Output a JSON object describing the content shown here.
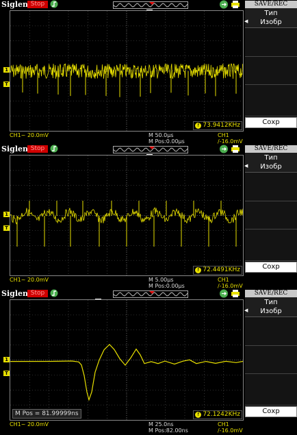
{
  "brand": "Siglent",
  "run_state": "Stop",
  "menu": {
    "title": "SAVE/REC",
    "type_label": "Тип",
    "type_value": "Изобр",
    "save_label": "Сохр"
  },
  "icons": {
    "trigger_mode": "trigger-edge-icon",
    "usb": "usb-icon",
    "print": "printer-icon",
    "trigger_position": "T",
    "channel_marker": "1",
    "trigger_level": "T"
  },
  "colors": {
    "trace": "#e8e000",
    "stop_badge": "#d00000",
    "grid": "#5a5a5a"
  },
  "panels": [
    {
      "frequency": "73.9412KHz",
      "channel": "CH1~ 20.0mV",
      "timebase": "M 50.0μs",
      "mpos": "M Pos:0.00μs",
      "trigger": "CH1 /-16.0mV",
      "waveform": "noise-dense"
    },
    {
      "frequency": "72.4491KHz",
      "channel": "CH1~ 20.0mV",
      "timebase": "M 5.00μs",
      "mpos": "M Pos:0.00μs",
      "trigger": "CH1 /-16.0mV",
      "waveform": "noise-periodic"
    },
    {
      "frequency": "72.1242KHz",
      "channel": "CH1~ 20.0mV",
      "timebase": "M 25.0ns",
      "mpos": "M Pos:82.00ns",
      "trigger": "CH1 /-16.0mV",
      "overlay_mpos": "M Pos = 81.99999ns",
      "waveform": "single-pulse"
    }
  ]
}
